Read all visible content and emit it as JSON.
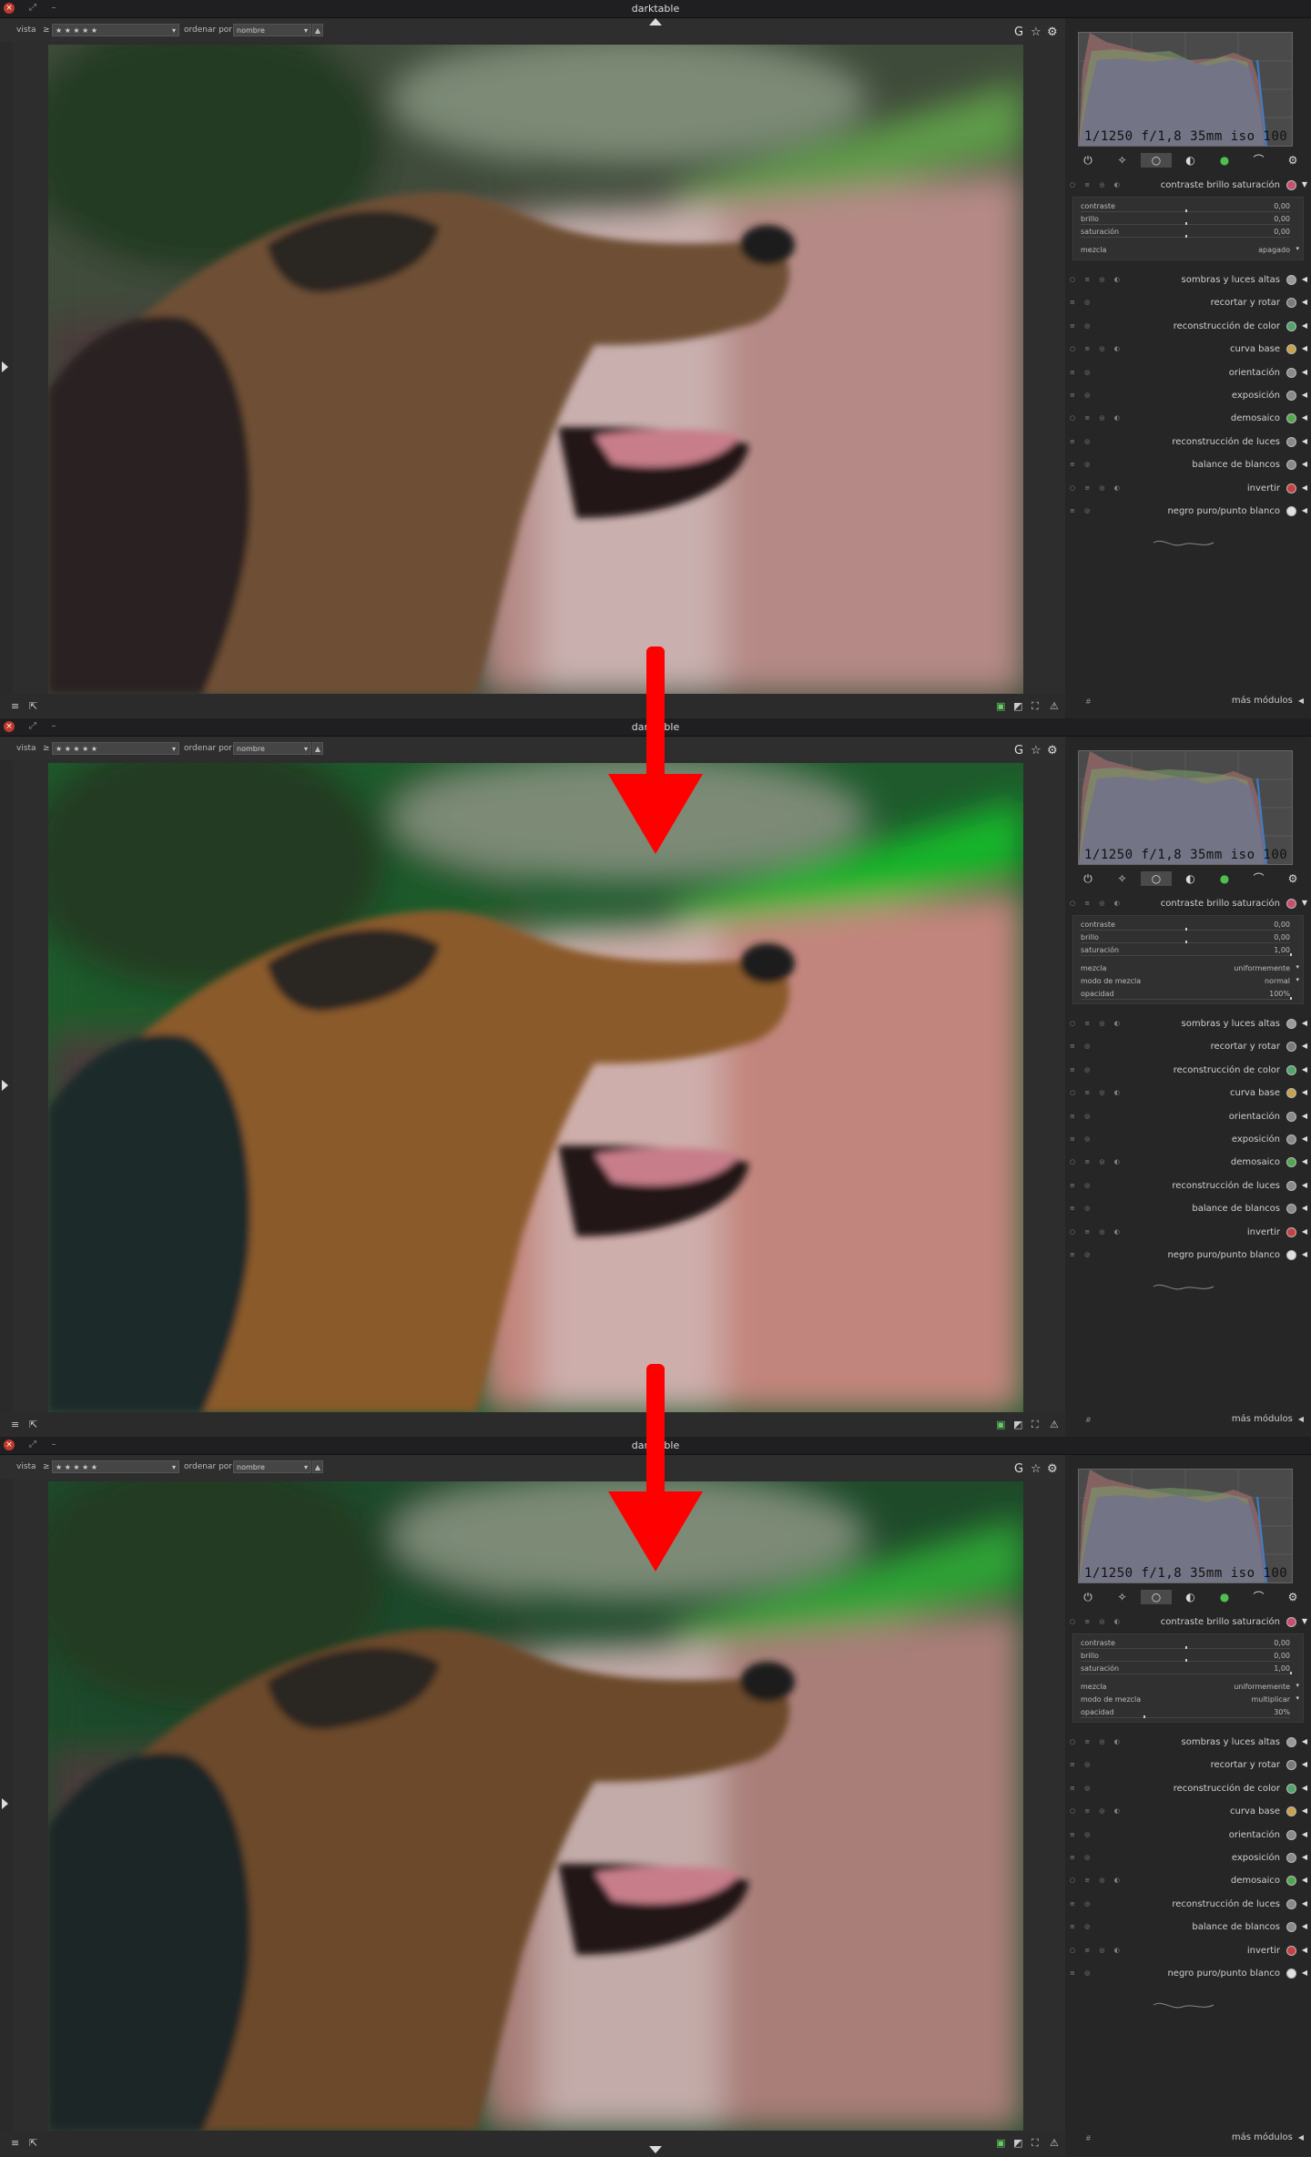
{
  "window": {
    "title": "darktable"
  },
  "toolbar": {
    "view_label": "vista",
    "rating_op": "≥",
    "rating_value": "★ ★ ★ ★ ★",
    "sort_label": "ordenar por",
    "sort_value": "nombre",
    "sort_dir": "▲",
    "icons": [
      "G",
      "☆",
      "⚙"
    ]
  },
  "exif_info": "1/1250 f/1,8 35mm iso 100",
  "module_group_icons": [
    "power-icon",
    "favorite-icon",
    "basic-circle-icon",
    "tone-icon",
    "color-icon",
    "correct-icon",
    "effect-icon"
  ],
  "modules": [
    "sombras y luces altas",
    "recortar y rotar",
    "reconstrucción de color",
    "curva base",
    "orientación",
    "exposición",
    "demosaico",
    "reconstrucción de luces",
    "balance de blancos",
    "invertir",
    "negro puro/punto blanco"
  ],
  "module_icon_colors": [
    "#9a9a9a",
    "#7a7a7a",
    "#4fa56a",
    "#c8a24a",
    "#8a8a8a",
    "#8a8a8a",
    "#4fa84f",
    "#8a8a8a",
    "#8a8a8a",
    "#c94040",
    "#e0e0e0"
  ],
  "expanded_module": "contraste brillo saturación",
  "more_modules": "más módulos",
  "hash": "#",
  "states": [
    {
      "params": [
        {
          "label": "contraste",
          "value": "0,00"
        },
        {
          "label": "brillo",
          "value": "0,00"
        },
        {
          "label": "saturación",
          "value": "0,00"
        }
      ],
      "blend": [
        {
          "label": "mezcla",
          "value": "apagado"
        }
      ]
    },
    {
      "params": [
        {
          "label": "contraste",
          "value": "0,00"
        },
        {
          "label": "brillo",
          "value": "0,00"
        },
        {
          "label": "saturación",
          "value": "1,00"
        }
      ],
      "blend": [
        {
          "label": "mezcla",
          "value": "uniformemente"
        },
        {
          "label": "modo de mezcla",
          "value": "normal"
        },
        {
          "label": "opacidad",
          "value": "100%"
        }
      ]
    },
    {
      "params": [
        {
          "label": "contraste",
          "value": "0,00"
        },
        {
          "label": "brillo",
          "value": "0,00"
        },
        {
          "label": "saturación",
          "value": "1,00"
        }
      ],
      "blend": [
        {
          "label": "mezcla",
          "value": "uniformemente"
        },
        {
          "label": "modo de mezcla",
          "value": "multiplicar"
        },
        {
          "label": "opacidad",
          "value": "30%"
        }
      ]
    }
  ],
  "arrow_color": "#ff0000"
}
